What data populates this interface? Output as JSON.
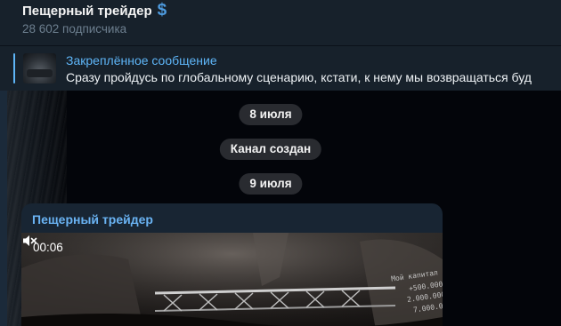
{
  "header": {
    "title": "Пещерный трейдер",
    "title_icon": "dollar-icon",
    "dollar_glyph": "$",
    "subscribers": "28 602 подписчика"
  },
  "pinned": {
    "label": "Закреплённое сообщение",
    "text": "Сразу пройдусь по глобальному сценарию, кстати, к нему мы возвращаться буд"
  },
  "chat": {
    "date1": "8 июля",
    "service": "Канал создан",
    "date2": "9 июля"
  },
  "message": {
    "author": "Пещерный трейдер",
    "video": {
      "timer": "00:06",
      "muted": true,
      "overlay_lines": [
        "Мой капитал",
        "+500.000",
        "2.000.000",
        "7.000.00"
      ]
    }
  },
  "colors": {
    "header_bg": "#17212b",
    "accent": "#5eb5f7",
    "author": "#6ab3f3",
    "bubble": "#182533"
  }
}
